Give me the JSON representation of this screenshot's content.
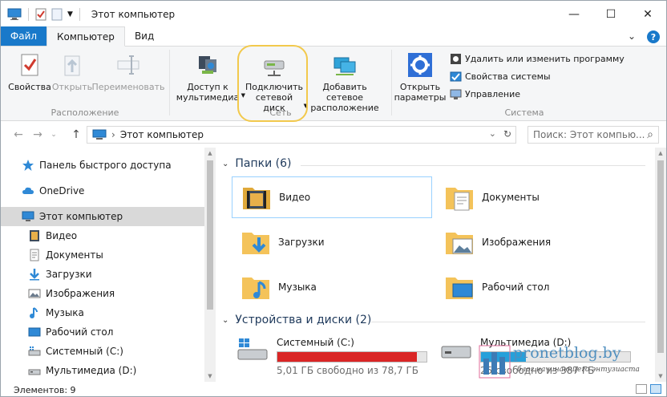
{
  "window": {
    "title": "Этот компьютер",
    "minimize_glyph": "—",
    "maximize_glyph": "☐",
    "close_glyph": "✕"
  },
  "ribbon_tabs": {
    "file": "Файл",
    "computer": "Компьютер",
    "view": "Вид",
    "collapse_glyph": "⌄",
    "help_glyph": "?"
  },
  "ribbon": {
    "location_group": {
      "label": "Расположение",
      "properties": "Свойства",
      "open": "Открыть",
      "rename": "Переименовать"
    },
    "network_group": {
      "label": "Сеть",
      "media_access_line1": "Доступ к",
      "media_access_line2": "мультимедиа",
      "map_drive_line1": "Подключить",
      "map_drive_line2": "сетевой диск",
      "add_location_line1": "Добавить сетевое",
      "add_location_line2": "расположение"
    },
    "system_group": {
      "label": "Система",
      "open_settings_line1": "Открыть",
      "open_settings_line2": "параметры",
      "uninstall": "Удалить или изменить программу",
      "system_properties": "Свойства системы",
      "manage": "Управление"
    }
  },
  "address_bar": {
    "path_separator": "›",
    "path": "Этот компьютер",
    "dropdown_glyph": "⌄",
    "refresh_glyph": "↻",
    "search_placeholder": "Поиск: Этот компью...",
    "search_glyph": "⌕"
  },
  "nav_pane": {
    "items": [
      {
        "label": "Панель быстрого доступа",
        "icon": "star-icon"
      },
      {
        "label": "OneDrive",
        "icon": "cloud-icon"
      },
      {
        "label": "Этот компьютер",
        "icon": "computer-icon"
      },
      {
        "label": "Видео",
        "icon": "video-icon"
      },
      {
        "label": "Документы",
        "icon": "documents-icon"
      },
      {
        "label": "Загрузки",
        "icon": "downloads-icon"
      },
      {
        "label": "Изображения",
        "icon": "pictures-icon"
      },
      {
        "label": "Музыка",
        "icon": "music-icon"
      },
      {
        "label": "Рабочий стол",
        "icon": "desktop-icon"
      },
      {
        "label": "Системный (C:)",
        "icon": "drive-c-icon"
      },
      {
        "label": "Мультимедиа (D:)",
        "icon": "drive-d-icon"
      }
    ]
  },
  "content": {
    "folders_header": "Папки (6)",
    "folders": [
      {
        "label": "Видео",
        "icon": "video-folder-icon"
      },
      {
        "label": "Документы",
        "icon": "documents-folder-icon"
      },
      {
        "label": "Загрузки",
        "icon": "downloads-folder-icon"
      },
      {
        "label": "Изображения",
        "icon": "pictures-folder-icon"
      },
      {
        "label": "Музыка",
        "icon": "music-folder-icon"
      },
      {
        "label": "Рабочий стол",
        "icon": "desktop-folder-icon"
      }
    ],
    "drives_header": "Устройства и диски (2)",
    "drives": [
      {
        "label": "Системный (C:)",
        "free": "5,01 ГБ свободно из 78,7 ГБ",
        "used_fraction": 0.936,
        "bar_color": "#da2626"
      },
      {
        "label": "Мультимедиа (D:)",
        "free": "25 свободно из 387 ГБ",
        "used_fraction": 0.3,
        "bar_color": "#26a0da"
      }
    ]
  },
  "status_bar": {
    "items_count": "Элементов: 9"
  },
  "watermark": {
    "text": "pronetblog.by",
    "subtext": "блог начинающего энтузиаста"
  },
  "colors": {
    "accent": "#1979ca",
    "folder": "#f4c35a",
    "selection": "#d9d9d9",
    "highlight_ring": "#f2c94c"
  }
}
